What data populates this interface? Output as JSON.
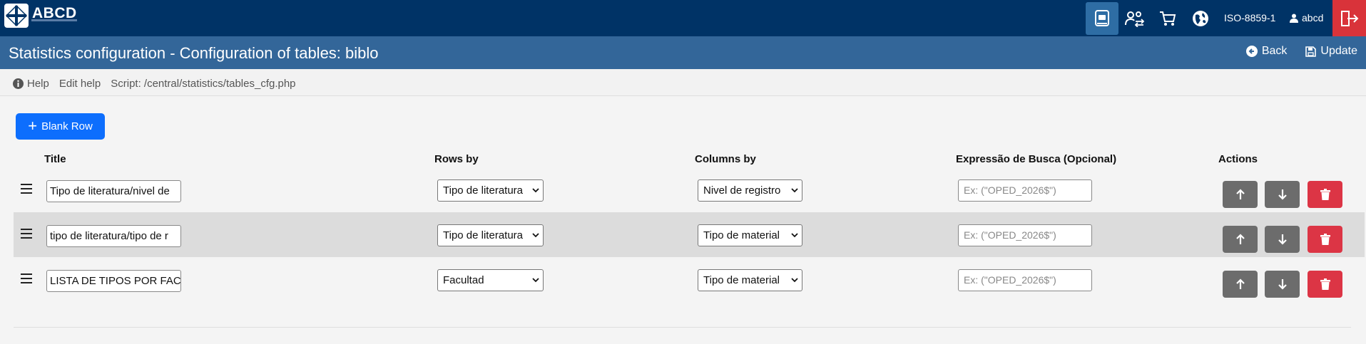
{
  "app": {
    "logo_text": "ABCD",
    "charset": "ISO-8859-1",
    "user": "abcd"
  },
  "nav_icons": [
    "catalog-icon",
    "users-exchange-icon",
    "cart-icon",
    "globe-icon"
  ],
  "page": {
    "title": "Statistics configuration - Configuration of tables: biblo",
    "back_label": "Back",
    "update_label": "Update"
  },
  "helpbar": {
    "help_label": "Help",
    "edit_help_label": "Edit help",
    "script_label": "Script: /central/statistics/tables_cfg.php"
  },
  "toolbar": {
    "blank_row_label": "Blank Row"
  },
  "table": {
    "headers": {
      "title": "Title",
      "rows_by": "Rows by",
      "columns_by": "Columns by",
      "expression": "Expressão de Busca (Opcional)",
      "actions": "Actions"
    },
    "rows": [
      {
        "title": "Tipo de literatura/nivel de",
        "rows_by": "Tipo de literatura",
        "columns_by": "Nivel de registro",
        "expression_placeholder": "Ex: (\"OPED_2026$\")"
      },
      {
        "title": "tipo de literatura/tipo de r",
        "rows_by": "Tipo de literatura",
        "columns_by": "Tipo de material",
        "expression_placeholder": "Ex: (\"OPED_2026$\")"
      },
      {
        "title": "LISTA DE TIPOS POR FACU",
        "rows_by": "Facultad",
        "columns_by": "Tipo de material",
        "expression_placeholder": "Ex: (\"OPED_2026$\")"
      }
    ]
  },
  "colors": {
    "topbar": "#003366",
    "titlebar": "#336699",
    "primary": "#0d6efd",
    "danger": "#dc3545",
    "secondary": "#6c6c6c"
  }
}
